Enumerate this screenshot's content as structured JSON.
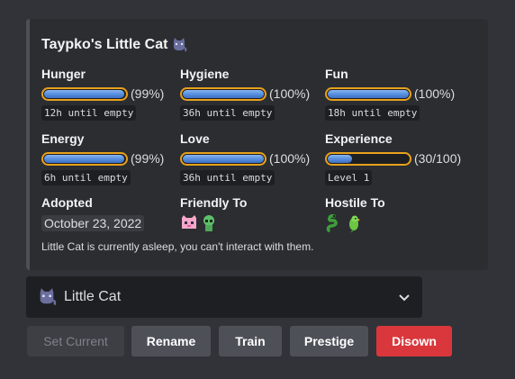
{
  "embed": {
    "title": "Taypko's Little Cat",
    "stats": [
      {
        "name": "Hunger",
        "percent_text": "(99%)",
        "fill": 0.99,
        "note": "12h until empty"
      },
      {
        "name": "Hygiene",
        "percent_text": "(100%)",
        "fill": 1.0,
        "note": "36h until empty"
      },
      {
        "name": "Fun",
        "percent_text": "(100%)",
        "fill": 1.0,
        "note": "18h until empty"
      },
      {
        "name": "Energy",
        "percent_text": "(99%)",
        "fill": 0.99,
        "note": "6h until empty"
      },
      {
        "name": "Love",
        "percent_text": "(100%)",
        "fill": 1.0,
        "note": "36h until empty"
      },
      {
        "name": "Experience",
        "percent_text": "(30/100)",
        "fill": 0.3,
        "note": "Level 1"
      }
    ],
    "adopted": {
      "name": "Adopted",
      "value": "October 23, 2022"
    },
    "friendly": {
      "name": "Friendly To",
      "icons": [
        "pink-cat-icon",
        "green-alien-icon"
      ]
    },
    "hostile": {
      "name": "Hostile To",
      "icons": [
        "snake-icon",
        "parrot-icon"
      ]
    },
    "status": "Little Cat is currently asleep, you can't interact with them."
  },
  "select": {
    "selected": "Little Cat",
    "icon": "cat-icon"
  },
  "buttons": {
    "set_current": "Set Current",
    "rename": "Rename",
    "train": "Train",
    "prestige": "Prestige",
    "disown": "Disown"
  },
  "colors": {
    "background": "#313338",
    "embed_bg": "#2b2d31",
    "bar_border": "#e8a11c",
    "bar_fill": "#5b93e0",
    "danger": "#da373c",
    "secondary_button": "#4e5058"
  }
}
